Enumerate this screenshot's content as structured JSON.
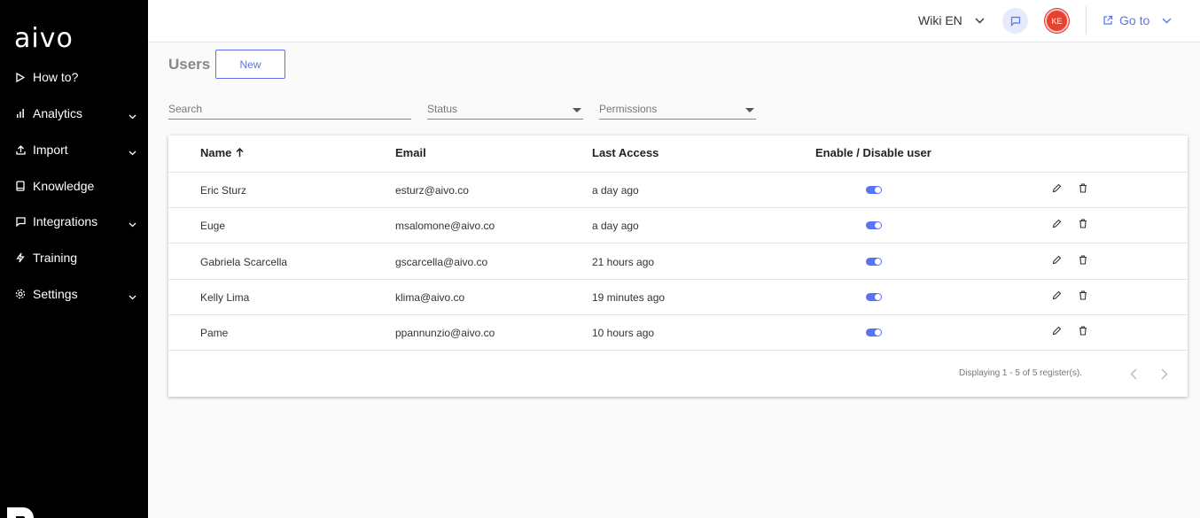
{
  "brand": {
    "logo_text": "aivo"
  },
  "sidebar": {
    "items": [
      {
        "label": "How to?",
        "icon": "play-icon",
        "has_submenu": false
      },
      {
        "label": "Analytics",
        "icon": "bar-chart-icon",
        "has_submenu": true
      },
      {
        "label": "Import",
        "icon": "upload-icon",
        "has_submenu": true
      },
      {
        "label": "Knowledge",
        "icon": "book-icon",
        "has_submenu": false
      },
      {
        "label": "Integrations",
        "icon": "chat-icon",
        "has_submenu": true
      },
      {
        "label": "Training",
        "icon": "lightning-icon",
        "has_submenu": false
      },
      {
        "label": "Settings",
        "icon": "gear-icon",
        "has_submenu": true
      }
    ]
  },
  "header": {
    "wiki_label": "Wiki EN",
    "avatar_initials": "KE",
    "goto_label": "Go to"
  },
  "page": {
    "title": "Users",
    "new_button": "New"
  },
  "filters": {
    "search_placeholder": "Search",
    "status_label": "Status",
    "permissions_label": "Permissions"
  },
  "table": {
    "columns": [
      "Name",
      "Email",
      "Last Access",
      "Enable / Disable user"
    ],
    "rows": [
      {
        "name": "Eric Sturz",
        "email": "esturz@aivo.co",
        "last_access": "a day ago",
        "enabled": true
      },
      {
        "name": "Euge",
        "email": "msalomone@aivo.co",
        "last_access": "a day ago",
        "enabled": true
      },
      {
        "name": "Gabriela Scarcella",
        "email": "gscarcella@aivo.co",
        "last_access": "21 hours ago",
        "enabled": true
      },
      {
        "name": "Kelly Lima",
        "email": "klima@aivo.co",
        "last_access": "19 minutes ago",
        "enabled": true
      },
      {
        "name": "Pame",
        "email": "ppannunzio@aivo.co",
        "last_access": "10 hours ago",
        "enabled": true
      }
    ],
    "footer": "Displaying 1 - 5 of 5 register(s)."
  },
  "colors": {
    "sidebar_bg": "#000000",
    "accent": "#5a73f0",
    "avatar": "#e5432f"
  }
}
